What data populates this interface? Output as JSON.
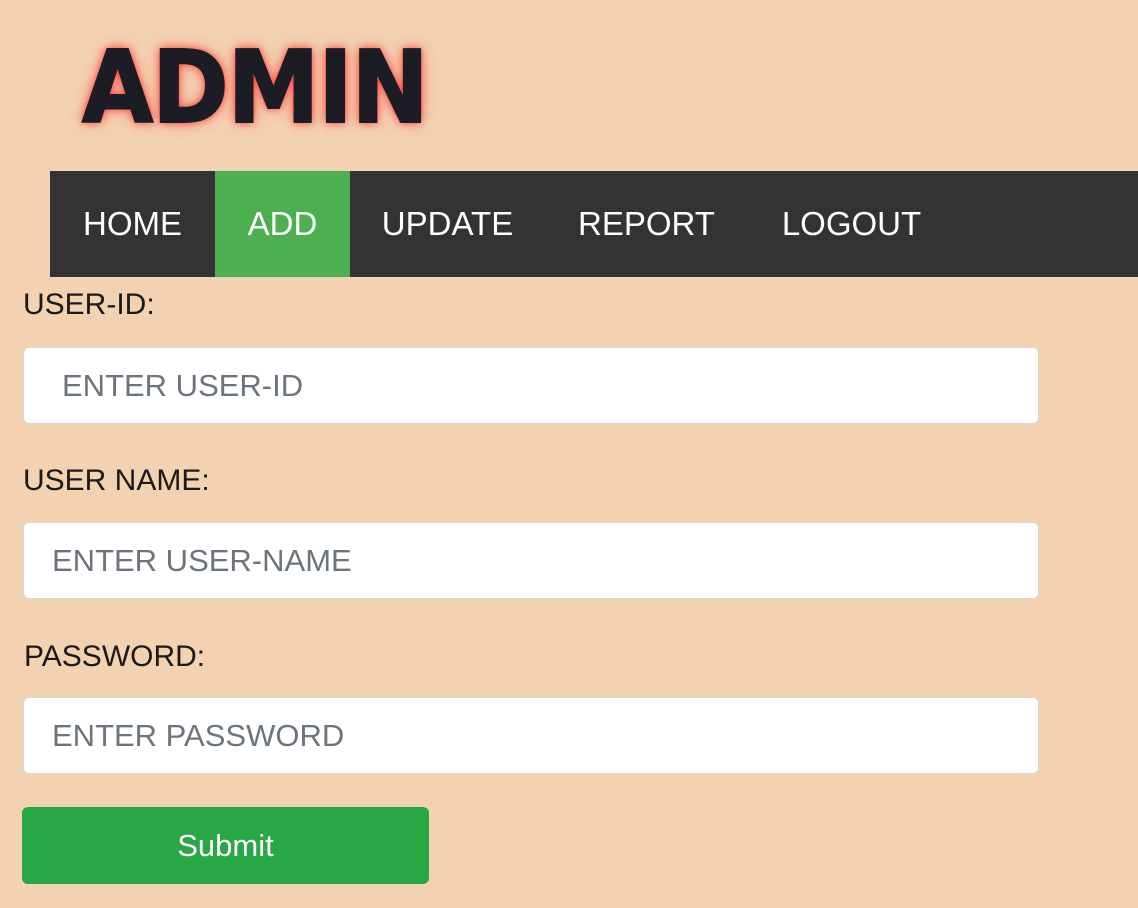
{
  "logo": {
    "text": "ADMIN"
  },
  "nav": {
    "items": [
      {
        "label": "HOME",
        "active": false
      },
      {
        "label": "ADD",
        "active": true
      },
      {
        "label": "UPDATE",
        "active": false
      },
      {
        "label": "REPORT",
        "active": false
      },
      {
        "label": "LOGOUT",
        "active": false
      }
    ]
  },
  "form": {
    "user_id": {
      "label": "USER-ID:",
      "placeholder": "ENTER USER-ID",
      "value": ""
    },
    "user_name": {
      "label": "USER NAME:",
      "placeholder": "ENTER USER-NAME",
      "value": ""
    },
    "password": {
      "label": "PASSWORD:",
      "placeholder": "ENTER PASSWORD",
      "value": ""
    },
    "submit_label": "Submit"
  },
  "colors": {
    "background": "#f2d2b1",
    "navbar": "#333333",
    "nav_active": "#4caf50",
    "submit": "#28a745",
    "logo_glow": "#ff2828"
  }
}
